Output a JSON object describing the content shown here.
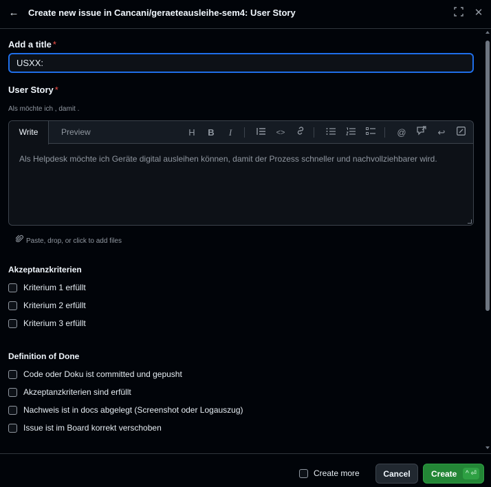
{
  "header": {
    "title": "Create new issue in Cancani/geraeteausleihe-sem4: User Story",
    "back_icon": "←",
    "maximize_icon": "⛶",
    "close_icon": "✕"
  },
  "title_field": {
    "label": "Add a title",
    "required_mark": "*",
    "value": "USXX: "
  },
  "user_story": {
    "label": "User Story",
    "required_mark": "*",
    "hint": "Als möchte ich , damit .",
    "tabs": {
      "write": "Write",
      "preview": "Preview"
    },
    "toolbar": [
      {
        "name": "heading-icon",
        "glyph": "H"
      },
      {
        "name": "bold-icon",
        "glyph": "B"
      },
      {
        "name": "italic-icon",
        "glyph": "I"
      },
      {
        "name": "quote-icon",
        "glyph": "❝"
      },
      {
        "name": "code-icon",
        "glyph": "<>"
      },
      {
        "name": "link-icon",
        "glyph": "🔗"
      },
      {
        "name": "bullet-list-icon",
        "glyph": "☰"
      },
      {
        "name": "numbered-list-icon",
        "glyph": "≡"
      },
      {
        "name": "task-list-icon",
        "glyph": "☑"
      },
      {
        "name": "mention-icon",
        "glyph": "@"
      },
      {
        "name": "reference-icon",
        "glyph": "⤴"
      },
      {
        "name": "reply-icon",
        "glyph": "↩"
      },
      {
        "name": "slash-command-icon",
        "glyph": "⧄"
      }
    ],
    "placeholder": "Als Helpdesk möchte ich Geräte digital ausleihen können, damit der Prozess schneller und nachvollziehbarer wird.",
    "attach_text": "Paste, drop, or click to add files",
    "attach_icon": "📎"
  },
  "acceptance": {
    "title": "Akzeptanzkriterien",
    "items": [
      "Kriterium 1 erfüllt",
      "Kriterium 2 erfüllt",
      "Kriterium 3 erfüllt"
    ]
  },
  "dod": {
    "title": "Definition of Done",
    "items": [
      "Code oder Doku ist committed und gepusht",
      "Akzeptanzkriterien sind erfüllt",
      "Nachweis ist in docs abgelegt (Screenshot oder Logauszug)",
      "Issue ist im Board korrekt verschoben"
    ]
  },
  "footer": {
    "create_more": "Create more",
    "cancel": "Cancel",
    "create": "Create",
    "create_shortcut": "^ ⏎"
  },
  "colors": {
    "background": "#010409",
    "input_focus_border": "#1f6feb",
    "required": "#f85149",
    "create_button": "#238636"
  }
}
